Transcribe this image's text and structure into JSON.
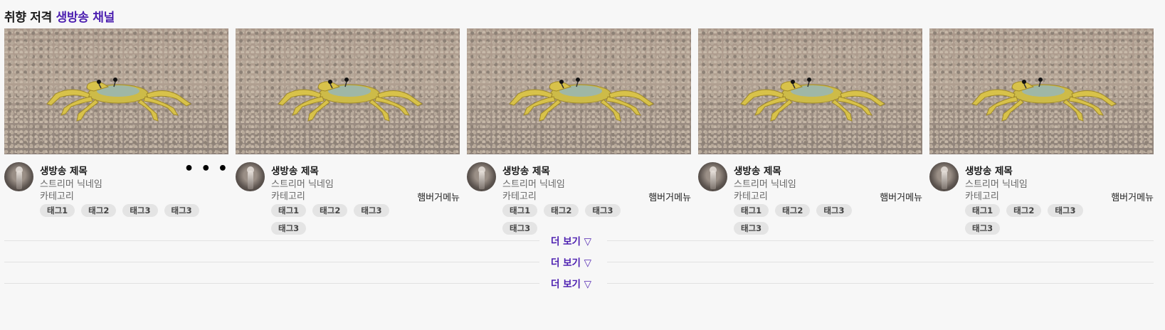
{
  "section": {
    "title_prefix": "취향 저격",
    "title_accent": "생방송 채널"
  },
  "cards": [
    {
      "title": "생방송 제목",
      "streamer": "스트리머 닉네임",
      "category": "카테고리",
      "menu_label": "• • •",
      "tags": [
        "태그1",
        "태그2",
        "태그3",
        "태그3"
      ]
    },
    {
      "title": "생방송 제목",
      "streamer": "스트리머 닉네임",
      "category": "카테고리",
      "menu_label": "햄버거메뉴",
      "tags": [
        "태그1",
        "태그2",
        "태그3",
        "태그3"
      ]
    },
    {
      "title": "생방송 제목",
      "streamer": "스트리머 닉네임",
      "category": "카테고리",
      "menu_label": "햄버거메뉴",
      "tags": [
        "태그1",
        "태그2",
        "태그3",
        "태그3"
      ]
    },
    {
      "title": "생방송 제목",
      "streamer": "스트리머 닉네임",
      "category": "카테고리",
      "menu_label": "햄버거메뉴",
      "tags": [
        "태그1",
        "태그2",
        "태그3",
        "태그3"
      ]
    },
    {
      "title": "생방송 제목",
      "streamer": "스트리머 닉네임",
      "category": "카테고리",
      "menu_label": "햄버거메뉴",
      "tags": [
        "태그1",
        "태그2",
        "태그3",
        "태그3"
      ]
    }
  ],
  "more_buttons": [
    "더 보기 ▽",
    "더 보기 ▽",
    "더 보기 ▽"
  ],
  "colors": {
    "accent": "#4c1fb0",
    "background": "#f7f7f7",
    "tag_bg": "#e4e4e4"
  }
}
